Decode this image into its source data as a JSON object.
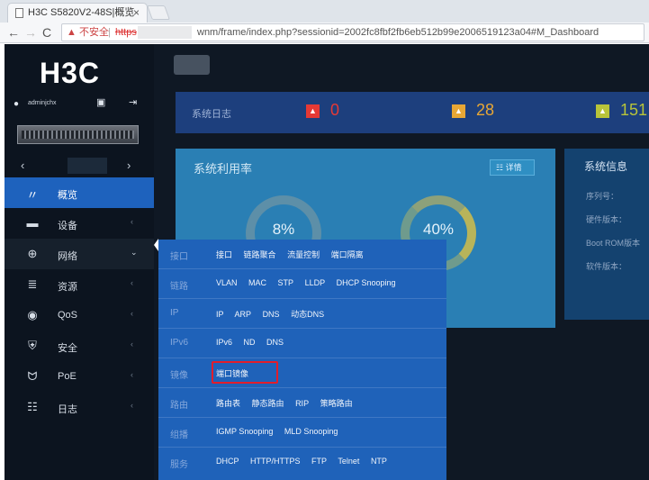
{
  "browser": {
    "tab_title": "H3C S5820V2-48S|概览",
    "tab_close": "×",
    "insecure_label": "▲ 不安全",
    "host": "https",
    "url_path": "wnm/frame/index.php?sessionid=2002fc8fbf2fb6eb512b99e2006519123a04#M_Dashboard",
    "separator": "|"
  },
  "sidebar": {
    "logo": "H3C",
    "username": "adminjchx",
    "menu": [
      {
        "label": "概览",
        "icon": "dashboard-icon",
        "glyph": "〃"
      },
      {
        "label": "设备",
        "icon": "device-icon",
        "glyph": "▬"
      },
      {
        "label": "网络",
        "icon": "globe-icon",
        "glyph": "⊕"
      },
      {
        "label": "资源",
        "icon": "database-icon",
        "glyph": "≣"
      },
      {
        "label": "QoS",
        "icon": "qos-icon",
        "glyph": "◉"
      },
      {
        "label": "安全",
        "icon": "shield-icon",
        "glyph": "⛨"
      },
      {
        "label": "PoE",
        "icon": "poe-icon",
        "glyph": "ᗢ"
      },
      {
        "label": "日志",
        "icon": "log-icon",
        "glyph": "☷"
      }
    ]
  },
  "logbar": {
    "title": "系统日志",
    "counts": [
      "0",
      "28",
      "151"
    ],
    "colors": [
      "#e53935",
      "#e8a735",
      "#b8c43a"
    ]
  },
  "util_card": {
    "title": "系统利用率",
    "detail": "☷ 详情",
    "cpu": "8%",
    "mem": "40%"
  },
  "info_card": {
    "title": "系统信息",
    "rows": [
      "序列号：",
      "硬件版本：",
      "Boot ROM版本",
      "软件版本："
    ]
  },
  "flyout": {
    "rows": [
      {
        "cat": "接口",
        "items": [
          "接口",
          "链路聚合",
          "流量控制",
          "端口隔离"
        ]
      },
      {
        "cat": "链路",
        "items": [
          "VLAN",
          "MAC",
          "STP",
          "LLDP",
          "DHCP Snooping"
        ]
      },
      {
        "cat": "IP",
        "items": [
          "IP",
          "ARP",
          "DNS",
          "动态DNS"
        ]
      },
      {
        "cat": "IPv6",
        "items": [
          "IPv6",
          "ND",
          "DNS"
        ]
      },
      {
        "cat": "镜像",
        "items": [
          "端口镜像"
        ]
      },
      {
        "cat": "路由",
        "items": [
          "路由表",
          "静态路由",
          "RIP",
          "策略路由"
        ]
      },
      {
        "cat": "组播",
        "items": [
          "IGMP Snooping",
          "MLD Snooping"
        ]
      },
      {
        "cat": "服务",
        "items": [
          "DHCP",
          "HTTP/HTTPS",
          "FTP",
          "Telnet",
          "NTP"
        ]
      }
    ]
  }
}
